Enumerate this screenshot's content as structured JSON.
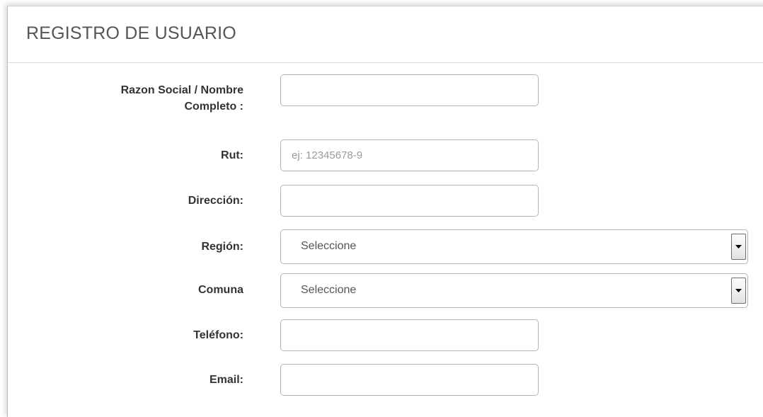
{
  "header": {
    "title": "REGISTRO DE USUARIO"
  },
  "form": {
    "razon_social": {
      "label_line1": "Razon Social / Nombre",
      "label_line2": "Completo :",
      "value": ""
    },
    "rut": {
      "label": "Rut:",
      "placeholder": "ej: 12345678-9",
      "value": ""
    },
    "direccion": {
      "label": "Dirección:",
      "value": ""
    },
    "region": {
      "label": "Región:",
      "selected": "Seleccione"
    },
    "comuna": {
      "label": "Comuna",
      "selected": "Seleccione"
    },
    "telefono": {
      "label": "Teléfono:",
      "value": ""
    },
    "email": {
      "label": "Email:",
      "value": ""
    }
  },
  "icons": {
    "dropdown": "chevron-down-icon"
  },
  "colors": {
    "title": "#555555",
    "label": "#333333",
    "border": "#b5b5b5",
    "placeholder": "#9a9a9a"
  }
}
